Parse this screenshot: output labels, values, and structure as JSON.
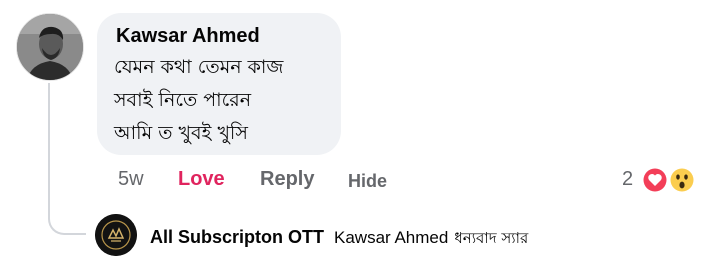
{
  "comment": {
    "author": "Kawsar Ahmed",
    "lines": [
      "যেমন কথা তেমন কাজ",
      "সবাই নিতে পারেন",
      "আমি ত খুবই খুসি"
    ],
    "time": "5w",
    "reaction_label": "Love",
    "reply_label": "Reply",
    "hide_label": "Hide",
    "reaction_count": "2",
    "reaction_icons": [
      "love-icon",
      "wow-icon"
    ]
  },
  "reply": {
    "author": "All Subscripton OTT",
    "mention": "Kawsar Ahmed",
    "text": "ধন্যবাদ স্যার"
  },
  "colors": {
    "bubble": "#f0f2f5",
    "love": "#e0245e",
    "muted": "#65676b"
  }
}
